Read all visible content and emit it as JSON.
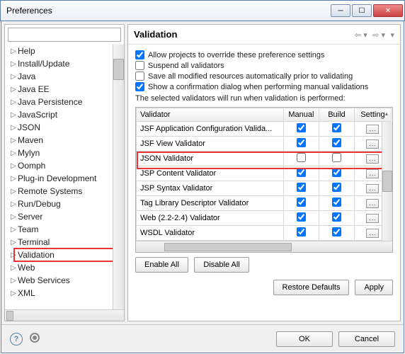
{
  "window_title": "Preferences",
  "filter_placeholder": "",
  "tree": [
    "Help",
    "Install/Update",
    "Java",
    "Java EE",
    "Java Persistence",
    "JavaScript",
    "JSON",
    "Maven",
    "Mylyn",
    "Oomph",
    "Plug-in Development",
    "Remote Systems",
    "Run/Debug",
    "Server",
    "Team",
    "Terminal",
    "Validation",
    "Web",
    "Web Services",
    "XML"
  ],
  "tree_selected": "Validation",
  "page_title": "Validation",
  "options": {
    "override": {
      "label": "Allow projects to override these preference settings",
      "checked": true
    },
    "suspend": {
      "label": "Suspend all validators",
      "checked": false
    },
    "save": {
      "label": "Save all modified resources automatically prior to validating",
      "checked": false
    },
    "confirm": {
      "label": "Show a confirmation dialog when performing manual validations",
      "checked": true
    }
  },
  "selected_text": "The selected validators will run when validation is performed:",
  "table": {
    "headers": {
      "validator": "Validator",
      "manual": "Manual",
      "build": "Build",
      "settings": "Setting"
    },
    "rows": [
      {
        "name": "JSF Application Configuration Valida...",
        "manual": true,
        "build": true,
        "settings": true,
        "hl": false
      },
      {
        "name": "JSF View Validator",
        "manual": true,
        "build": true,
        "settings": true,
        "hl": false
      },
      {
        "name": "JSON Validator",
        "manual": false,
        "build": false,
        "settings": true,
        "hl": true
      },
      {
        "name": "JSP Content Validator",
        "manual": true,
        "build": true,
        "settings": true,
        "hl": false
      },
      {
        "name": "JSP Syntax Validator",
        "manual": true,
        "build": true,
        "settings": true,
        "hl": false
      },
      {
        "name": "Tag Library Descriptor Validator",
        "manual": true,
        "build": true,
        "settings": true,
        "hl": false
      },
      {
        "name": "Web (2.2-2.4) Validator",
        "manual": true,
        "build": true,
        "settings": true,
        "hl": false
      },
      {
        "name": "WSDL Validator",
        "manual": true,
        "build": true,
        "settings": true,
        "hl": false
      }
    ]
  },
  "buttons": {
    "enable_all": "Enable All",
    "disable_all": "Disable All",
    "restore": "Restore Defaults",
    "apply": "Apply",
    "ok": "OK",
    "cancel": "Cancel"
  }
}
